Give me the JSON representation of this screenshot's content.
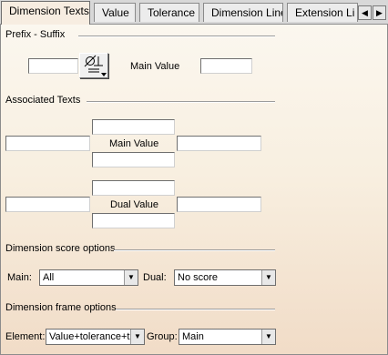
{
  "tabs": [
    "Dimension Texts",
    "Value",
    "Tolerance",
    "Dimension Line",
    "Extension Li"
  ],
  "prefix_suffix": {
    "title": "Prefix - Suffix",
    "main_value_label": "Main Value"
  },
  "associated_texts": {
    "title": "Associated Texts",
    "main_value_label": "Main Value",
    "dual_value_label": "Dual Value"
  },
  "score_options": {
    "title": "Dimension score options",
    "main_label": "Main:",
    "main_value": "All",
    "dual_label": "Dual:",
    "dual_value": "No score"
  },
  "frame_options": {
    "title": "Dimension frame options",
    "element_label": "Element:",
    "element_value": "Value+tolerance+t",
    "group_label": "Group:",
    "group_value": "Main"
  },
  "icons": {
    "scroll_left": "triangle-left-icon",
    "scroll_right": "triangle-right-icon",
    "symbol": "diameter-symbol-icon",
    "dropdown": "chevron-down-icon"
  }
}
